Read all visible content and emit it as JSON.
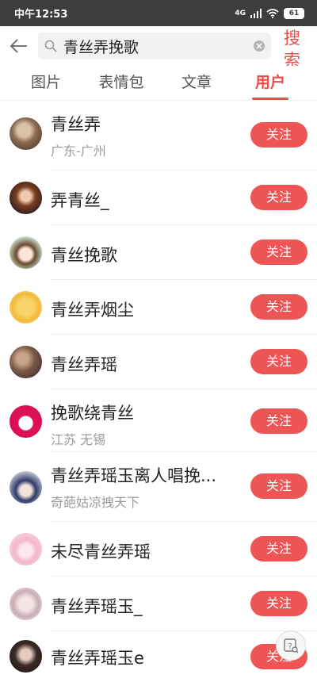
{
  "status": {
    "time": "中午12:53",
    "network": "4G",
    "battery": "61"
  },
  "search": {
    "query": "青丝弄挽歌",
    "submit_label": "搜索"
  },
  "tabs": [
    {
      "label": "图片",
      "active": false
    },
    {
      "label": "表情包",
      "active": false
    },
    {
      "label": "文章",
      "active": false
    },
    {
      "label": "用户",
      "active": true
    }
  ],
  "users": [
    {
      "name": "青丝弄",
      "location": "广东-广州",
      "follow_label": "关注"
    },
    {
      "name": "弄青丝_",
      "location": "",
      "follow_label": "关注"
    },
    {
      "name": "青丝挽歌",
      "location": "",
      "follow_label": "关注"
    },
    {
      "name": "青丝弄烟尘",
      "location": "",
      "follow_label": "关注"
    },
    {
      "name": "青丝弄瑶",
      "location": "",
      "follow_label": "关注"
    },
    {
      "name": "挽歌绕青丝",
      "location": "江苏 无锡",
      "follow_label": "关注"
    },
    {
      "name": "青丝弄瑶玉离人唱挽...",
      "location": "奇葩姑凉拽天下",
      "follow_label": "关注"
    },
    {
      "name": "未尽青丝弄瑶",
      "location": "",
      "follow_label": "关注"
    },
    {
      "name": "青丝弄瑶玉_",
      "location": "",
      "follow_label": "关注"
    },
    {
      "name": "青丝弄瑶玉e",
      "location": "",
      "follow_label": "关注"
    }
  ],
  "colors": {
    "accent": "#ef4b4b",
    "status_bar": "#3d3d3d"
  }
}
